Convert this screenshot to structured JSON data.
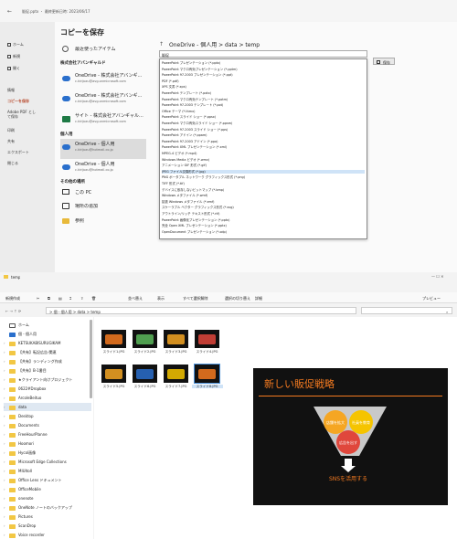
{
  "ppt": {
    "titlebar": "販促.pptx ・ 最終更新日時: 2023/06/17",
    "nav": [
      "ホーム",
      "新規",
      "開く",
      "情報",
      "コピーを保存",
      "Adobe PDF として保存",
      "印刷",
      "共有",
      "エクスポート",
      "閉じる"
    ],
    "heading": "コピーを保存",
    "recent": "最近使ったアイテム",
    "section_org": "株式会社アバンギャルド",
    "locations_org": [
      {
        "name": "OneDrive - 株式会社アバンギ...",
        "sub": "c.kirijozu@avg.onmicrosoft.com"
      },
      {
        "name": "OneDrive - 株式会社アバンギ...",
        "sub": "c.kirijozu@avg.onmicrosoft.com"
      },
      {
        "name": "サイト - 株式会社アバンギャル...",
        "sub": "c.kirijozu@avg.onmicrosoft.com"
      }
    ],
    "section_personal": "個人用",
    "locations_personal": [
      {
        "name": "OneDrive - 個人用",
        "sub": "c.kirijozu@hotmail.co.jp"
      },
      {
        "name": "OneDrive - 個人用",
        "sub": "c.kirijozu@hotmail.co.jp"
      }
    ],
    "section_other": "その他の場所",
    "other": [
      "この PC",
      "場所の追加",
      "参照"
    ],
    "breadcrumb": "OneDrive - 個人用 > data > temp",
    "filename": "販促",
    "save_button": "保存",
    "dropdown_options": [
      "PowerPoint プレゼンテーション (*.pptx)",
      "PowerPoint マクロ有効プレゼンテーション (*.pptm)",
      "PowerPoint 97-2003 プレゼンテーション (*.ppt)",
      "PDF (*.pdf)",
      "XPS 文書 (*.xps)",
      "PowerPoint テンプレート (*.potx)",
      "PowerPoint マクロ有効テンプレート (*.potm)",
      "PowerPoint 97-2003 テンプレート (*.pot)",
      "Office テーマ (*.thmx)",
      "PowerPoint スライド ショー (*.ppsx)",
      "PowerPoint マクロ有効スライド ショー (*.ppsm)",
      "PowerPoint 97-2003 スライド ショー (*.pps)",
      "PowerPoint アドイン (*.ppam)",
      "PowerPoint 97-2003 アドイン (*.ppa)",
      "PowerPoint XML プレゼンテーション (*.xml)",
      "MPEG-4 ビデオ (*.mp4)",
      "Windows Media ビデオ (*.wmv)",
      "アニメーション GIF 形式 (*.gif)",
      "JPEG ファイル交換形式 (*.jpg)",
      "PNG ポータブル ネットワーク グラフィックス形式 (*.png)",
      "TIFF 形式 (*.tif)",
      "デバイスに依存しないビットマップ (*.bmp)",
      "Windows メタファイル (*.wmf)",
      "拡張 Windows メタファイル (*.emf)",
      "スケーラブル ベクター グラフィックス形式 (*.svg)",
      "アウトライン/リッチ テキスト形式 (*.rtf)",
      "PowerPoint 画像化プレゼンテーション (*.pptx)",
      "完全 Open XML プレゼンテーション (*.pptx)",
      "OpenDocument プレゼンテーション (*.odp)"
    ],
    "selected_index": 18
  },
  "explorer": {
    "titlebar": "temp",
    "toolbar": [
      "新規作成",
      "切り取り",
      "コピー",
      "貼り付け",
      "名前の変更",
      "共有",
      "削除",
      "並べ替え",
      "表示",
      "すべて選択解除",
      "選択の切り替え",
      "詳細"
    ],
    "preview_label": "プレビュー",
    "breadcrumb": "> 個 - 個人用 > data > temp",
    "sidebar": [
      "ホーム",
      "個 - 個人用",
      "KETSUKABISURUGIKAM",
      "【共有】転記広告-関連",
      "【共有】ランディング作成",
      "【共有】B-1番目",
      "★クライアント向けプロジェクト",
      "0622#Dropbox",
      "ArcoleBeituo",
      "data",
      "Desktop",
      "Documents",
      "FreeHourPlanne",
      "Hoomori",
      "Hycol画像",
      "Microsoft Edge Collections",
      "MIUItoll",
      "Office Lens ドキュメント",
      "OfficeMobile",
      "onenote",
      "OneNote ノートのバックアップ",
      "Pictures",
      "ScanDrop",
      "Voice recorder"
    ],
    "files": [
      "スライド1.JPG",
      "スライド2.JPG",
      "スライド3.JPG",
      "スライド4.JPG",
      "スライド5.JPG",
      "スライド6.JPG",
      "スライド7.JPG",
      "スライド8.JPG"
    ],
    "preview": {
      "title": "新しい販促戦略",
      "circles": [
        "店舗を拡大",
        "社員を教育",
        "広告を出す"
      ],
      "result": "SNSを活用する"
    }
  },
  "colors": {
    "ppt_accent": "#b7472a",
    "onedrive": "#2a6fcc",
    "selection": "#cfe3f7",
    "folder": "#f2c744",
    "slide_bg": "#111111",
    "slide_title": "#f47a20"
  }
}
